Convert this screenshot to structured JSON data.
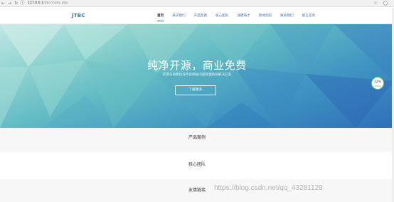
{
  "browser": {
    "url_host": "127.0.0.1",
    "url_path": "/jtbc/index.php"
  },
  "header": {
    "logo": "JTBC",
    "nav": [
      {
        "label": "首页",
        "active": true
      },
      {
        "label": "关于我们"
      },
      {
        "label": "产品案例"
      },
      {
        "label": "核心团队"
      },
      {
        "label": "诚聘英才"
      },
      {
        "label": "新闻动态"
      },
      {
        "label": "联系我们"
      },
      {
        "label": "留言咨询"
      }
    ]
  },
  "hero": {
    "title": "纯净开源，商业免费",
    "subtitle": "开源与免费的双平台网站内容管理系统解决方案",
    "button": "了解更多"
  },
  "badge": {
    "percent": "12%",
    "sub": "0.0K/s"
  },
  "sections": [
    {
      "title": "产品案例"
    },
    {
      "title": "核心团队"
    },
    {
      "title": "友情链接"
    }
  ],
  "watermark": "https://blog.csdn.net/qq_43281129",
  "colors": {
    "accent": "#3a6fc4",
    "hero_start": "#bfe7e6",
    "hero_end": "#2f6fb8",
    "badge_ring": "#5cc37a"
  }
}
